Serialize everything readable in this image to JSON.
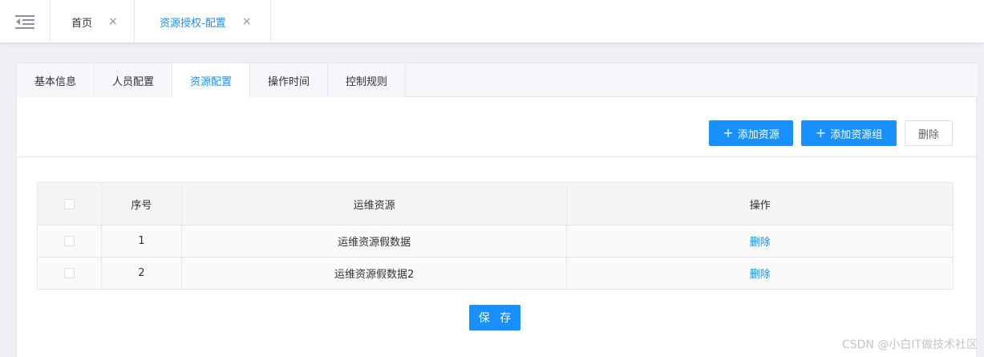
{
  "topbar": {
    "menu_icon": "menu-fold-icon",
    "tabs": [
      {
        "label": "首页",
        "close": "×"
      },
      {
        "label": "资源授权-配置",
        "close": "×"
      }
    ]
  },
  "subtabs": [
    "基本信息",
    "人员配置",
    "资源配置",
    "操作时间",
    "控制规则"
  ],
  "toolbar": {
    "add_resource": "添加资源",
    "add_group": "添加资源组",
    "delete": "删除",
    "plus_icon": "plus-icon"
  },
  "table": {
    "headers": [
      "序号",
      "运维资源",
      "操作"
    ],
    "rows": [
      {
        "index": "1",
        "resource": "运维资源假数据",
        "action": "删除"
      },
      {
        "index": "2",
        "resource": "运维资源假数据2",
        "action": "删除"
      }
    ]
  },
  "save_label": "保 存",
  "watermark": "CSDN @小白IT做技术社区",
  "colors": {
    "accent": "#1890ff",
    "background": "#f0f0f4"
  }
}
